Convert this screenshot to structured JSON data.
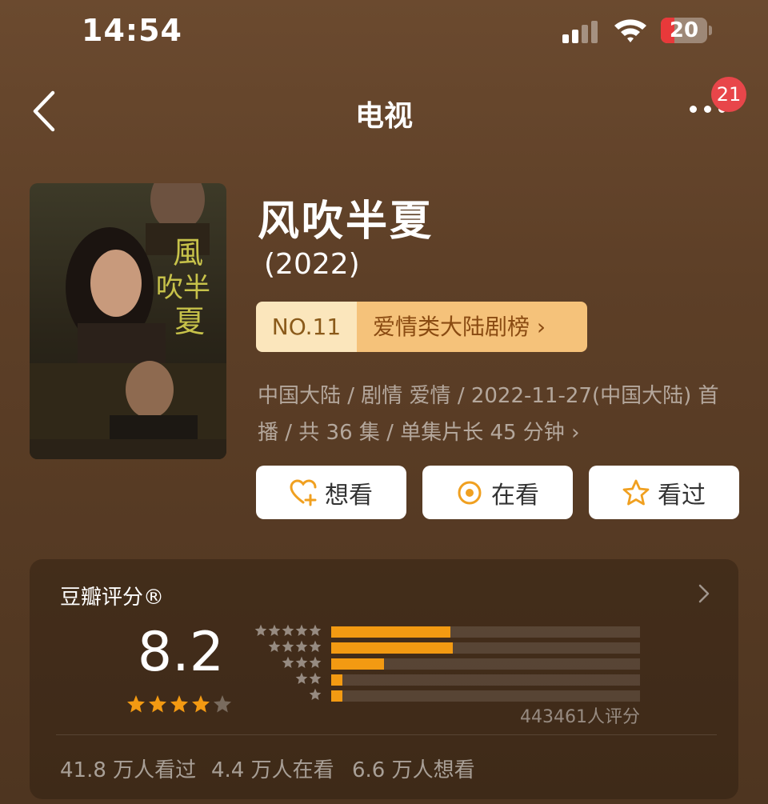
{
  "status_bar": {
    "time": "14:54",
    "battery_level": "20"
  },
  "nav": {
    "title": "电视",
    "notification_count": "21"
  },
  "movie": {
    "title": "风吹半夏",
    "year": "(2022)",
    "rank_no": "NO.11",
    "rank_category": "爱情类大陆剧榜 ›",
    "meta_line1": "中国大陆 / 剧情 爱情 / 2022-11-27(中国大陆) 首",
    "meta_line2": "播 / 共 36 集 / 单集片长 45 分钟 ›"
  },
  "actions": {
    "want": "想看",
    "watching": "在看",
    "watched": "看过"
  },
  "rating": {
    "label": "豆瓣评分®",
    "score": "8.2",
    "stars": 4,
    "distribution": [
      {
        "stars": 5,
        "fraction": 0.385
      },
      {
        "stars": 4,
        "fraction": 0.395
      },
      {
        "stars": 3,
        "fraction": 0.17
      },
      {
        "stars": 2,
        "fraction": 0.035
      },
      {
        "stars": 1,
        "fraction": 0.035
      }
    ],
    "count": "443461人评分",
    "watched": "41.8 万人看过",
    "watching": "4.4 万人在看",
    "want": "6.6 万人想看"
  },
  "colors": {
    "accent": "#f39a12",
    "badge": "#e8464a",
    "rank_light": "#fbe6bc",
    "rank_dark": "#f5c27a"
  }
}
